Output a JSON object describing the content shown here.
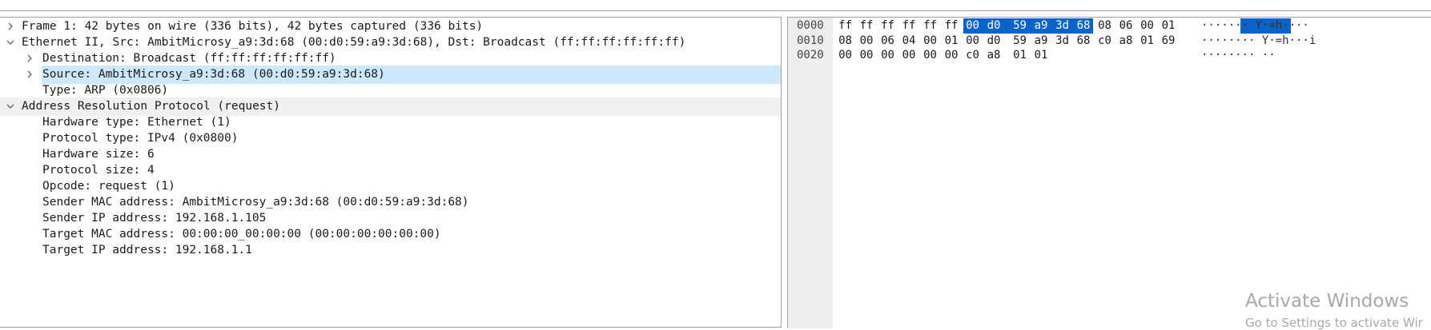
{
  "details": {
    "rows": [
      {
        "text": "Frame 1: 42 bytes on wire (336 bits), 42 bytes captured (336 bits)",
        "expander": "collapsed"
      },
      {
        "text": "Ethernet II, Src: AmbitMicrosy_a9:3d:68 (00:d0:59:a9:3d:68), Dst: Broadcast (ff:ff:ff:ff:ff:ff)",
        "expander": "expanded"
      },
      {
        "text": "Destination: Broadcast (ff:ff:ff:ff:ff:ff)",
        "expander": "collapsed"
      },
      {
        "text": "Source: AmbitMicrosy_a9:3d:68 (00:d0:59:a9:3d:68)",
        "expander": "collapsed"
      },
      {
        "text": "Type: ARP (0x0806)",
        "expander": "none"
      },
      {
        "text": "Address Resolution Protocol (request)",
        "expander": "expanded"
      },
      {
        "text": "Hardware type: Ethernet (1)",
        "expander": "none"
      },
      {
        "text": "Protocol type: IPv4 (0x0800)",
        "expander": "none"
      },
      {
        "text": "Hardware size: 6",
        "expander": "none"
      },
      {
        "text": "Protocol size: 4",
        "expander": "none"
      },
      {
        "text": "Opcode: request (1)",
        "expander": "none"
      },
      {
        "text": "Sender MAC address: AmbitMicrosy_a9:3d:68 (00:d0:59:a9:3d:68)",
        "expander": "none"
      },
      {
        "text": "Sender IP address: 192.168.1.105",
        "expander": "none"
      },
      {
        "text": "Target MAC address: 00:00:00_00:00:00 (00:00:00:00:00:00)",
        "expander": "none"
      },
      {
        "text": "Target IP address: 192.168.1.1",
        "expander": "none"
      }
    ],
    "selected_row": "Source: AmbitMicrosy_a9:3d:68 (00:d0:59:a9:3d:68)"
  },
  "hex": {
    "lines": [
      {
        "offset": "0000",
        "bytes": [
          "ff",
          "ff",
          "ff",
          "ff",
          "ff",
          "ff",
          "00",
          "d0",
          "59",
          "a9",
          "3d",
          "68",
          "08",
          "06",
          "00",
          "01"
        ],
        "ascii": "······· Y·=h····"
      },
      {
        "offset": "0010",
        "bytes": [
          "08",
          "00",
          "06",
          "04",
          "00",
          "01",
          "00",
          "d0",
          "59",
          "a9",
          "3d",
          "68",
          "c0",
          "a8",
          "01",
          "69"
        ],
        "ascii": "········ Y·=h···i"
      },
      {
        "offset": "0020",
        "bytes": [
          "00",
          "00",
          "00",
          "00",
          "00",
          "00",
          "c0",
          "a8",
          "01",
          "01"
        ],
        "ascii": "········ ··"
      }
    ],
    "highlighted_bytes_line0": "00 d0  59 a9 3d 68",
    "highlighted_ascii_line0": "· Y·=h"
  },
  "watermark": {
    "title": "Activate Windows",
    "subtitle": "Go to Settings to activate Wir"
  },
  "colors": {
    "selection": "#cde8fd",
    "hex_highlight": "#0a64c8",
    "gray_row": "#f0f0f0"
  }
}
